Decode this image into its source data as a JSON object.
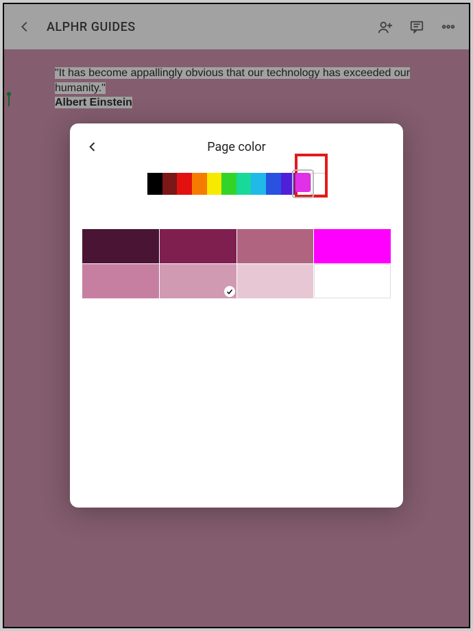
{
  "header": {
    "title": "ALPHR GUIDES"
  },
  "document": {
    "quote_part1": "\"It has become appallingly obvious that our technology has exceeded our",
    "quote_part2": "humanity.\"",
    "author": "Albert Einstein"
  },
  "modal": {
    "title": "Page color",
    "hues": [
      {
        "name": "black",
        "color": "#000000"
      },
      {
        "name": "maroon",
        "color": "#7a1717"
      },
      {
        "name": "red",
        "color": "#e31010"
      },
      {
        "name": "orange",
        "color": "#f57c00"
      },
      {
        "name": "yellow",
        "color": "#f7e900"
      },
      {
        "name": "green",
        "color": "#32d527"
      },
      {
        "name": "teal",
        "color": "#18d99a"
      },
      {
        "name": "cyan",
        "color": "#20b9e8"
      },
      {
        "name": "blue",
        "color": "#2a52e0"
      },
      {
        "name": "indigo",
        "color": "#5020d8"
      },
      {
        "name": "magenta",
        "color": "#e030e8",
        "selected": true
      },
      {
        "name": "white",
        "color": "#ffffff"
      }
    ],
    "shades": [
      {
        "color": "#4a1534"
      },
      {
        "color": "#7e1f50"
      },
      {
        "color": "#b0647f"
      },
      {
        "color": "#ff00ff"
      },
      {
        "color": "#c77fa1"
      },
      {
        "color": "#cf9ab2",
        "selected": true
      },
      {
        "color": "#e8c7d4"
      },
      {
        "color": "#ffffff"
      }
    ]
  }
}
